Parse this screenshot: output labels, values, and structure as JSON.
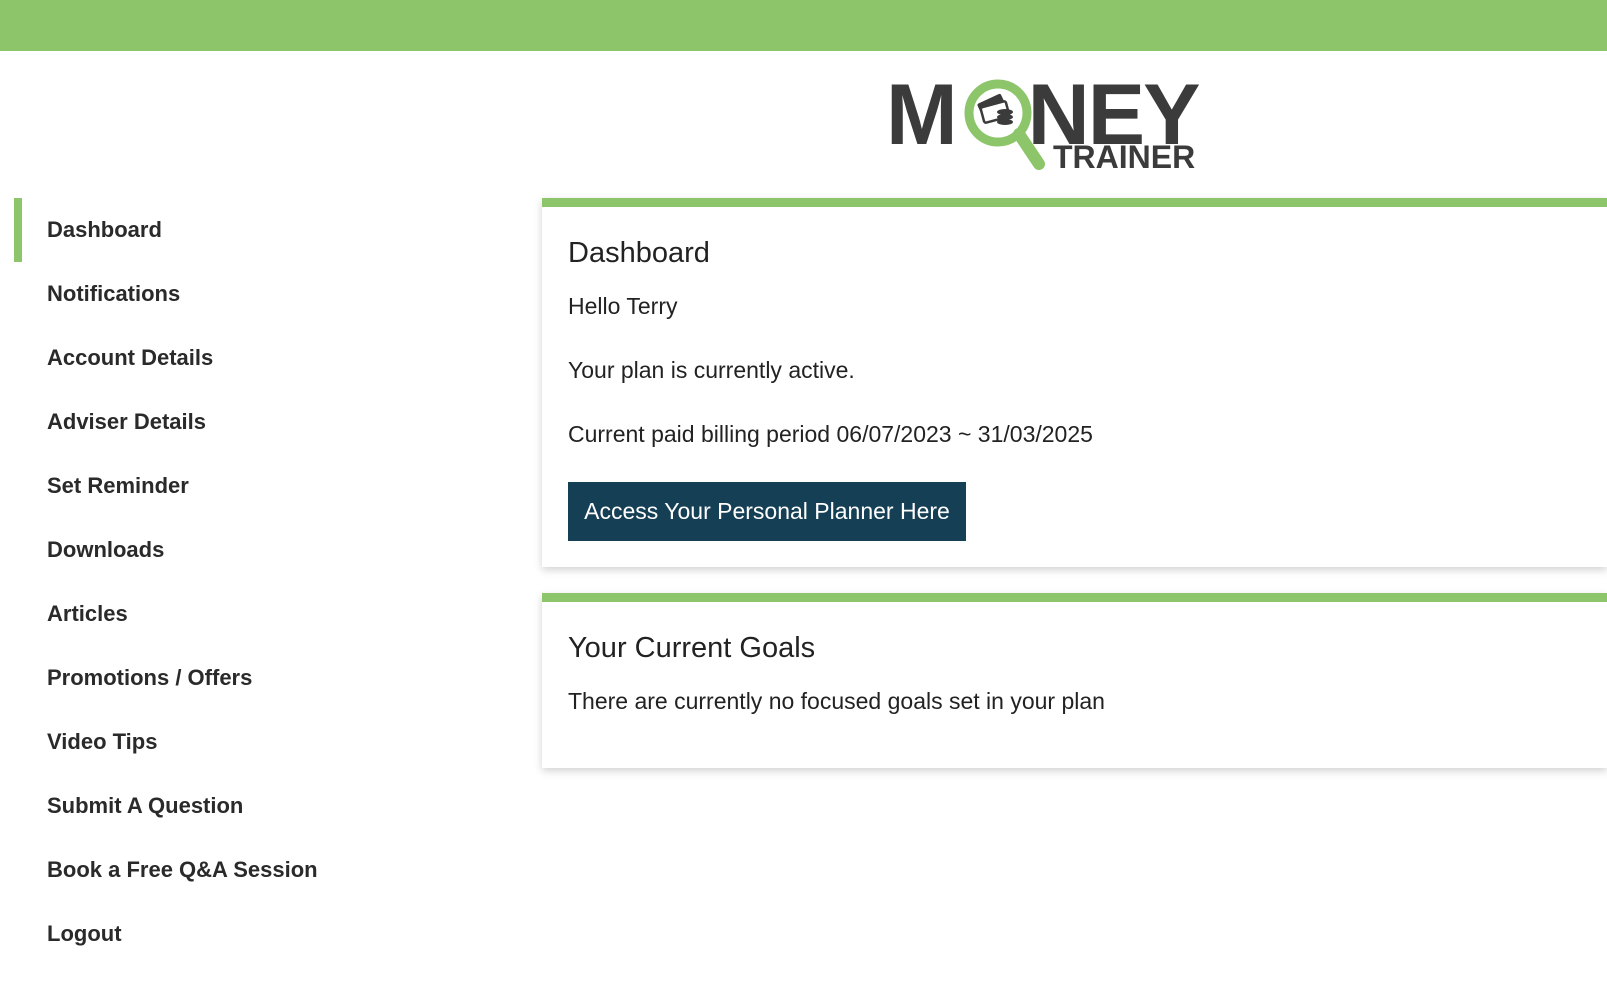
{
  "brand": {
    "logo_word": "MONEY",
    "logo_sub": "TRAINER",
    "accent_color": "#8dc56a",
    "dark_color": "#3b3b3b",
    "button_color": "#153f55"
  },
  "sidebar": {
    "items": [
      {
        "label": "Dashboard",
        "active": true
      },
      {
        "label": "Notifications"
      },
      {
        "label": "Account Details"
      },
      {
        "label": "Adviser Details"
      },
      {
        "label": "Set Reminder"
      },
      {
        "label": "Downloads"
      },
      {
        "label": "Articles"
      },
      {
        "label": "Promotions / Offers"
      },
      {
        "label": "Video Tips"
      },
      {
        "label": "Submit A Question"
      },
      {
        "label": "Book a Free Q&A Session"
      },
      {
        "label": "Logout"
      }
    ]
  },
  "dashboard": {
    "title": "Dashboard",
    "greeting": "Hello Terry",
    "plan_status": "Your plan is currently active.",
    "billing_period": "Current paid billing period 06/07/2023 ~ 31/03/2025",
    "planner_button": "Access Your Personal Planner Here"
  },
  "goals": {
    "title": "Your Current Goals",
    "empty_message": "There are currently no focused goals set in your plan"
  }
}
